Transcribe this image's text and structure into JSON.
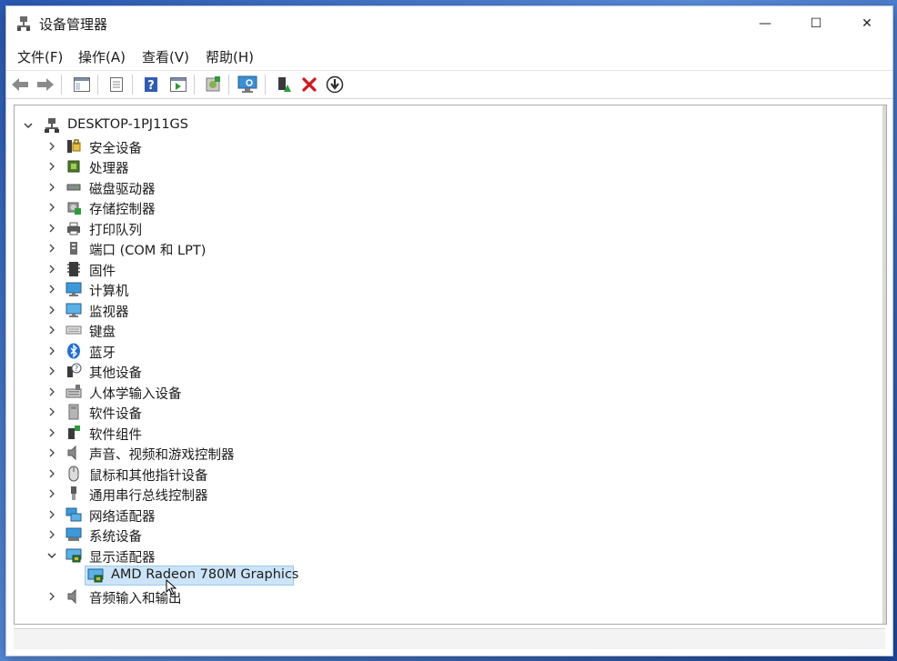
{
  "window": {
    "title": "设备管理器",
    "controls": {
      "minimize": "—",
      "maximize": "☐",
      "close": "✕"
    }
  },
  "menubar": {
    "items": [
      {
        "label": "文件(F)"
      },
      {
        "label": "操作(A)"
      },
      {
        "label": "查看(V)"
      },
      {
        "label": "帮助(H)"
      }
    ]
  },
  "toolbar": {
    "buttons": [
      {
        "icon": "back-arrow-icon"
      },
      {
        "icon": "forward-arrow-icon"
      },
      {
        "icon": "show-hide-console-tree-icon"
      },
      {
        "icon": "properties-icon"
      },
      {
        "icon": "help-icon"
      },
      {
        "icon": "action-pane-icon"
      },
      {
        "icon": "update-driver-icon"
      },
      {
        "icon": "scan-hardware-icon"
      },
      {
        "icon": "enable-device-icon"
      },
      {
        "icon": "uninstall-device-icon"
      },
      {
        "icon": "install-legacy-icon"
      }
    ]
  },
  "tree": {
    "root": {
      "label": "DESKTOP-1PJ11GS",
      "expanded": true
    },
    "categories": [
      {
        "label": "安全设备",
        "icon": "security-device-icon",
        "expanded": false
      },
      {
        "label": "处理器",
        "icon": "processor-icon",
        "expanded": false
      },
      {
        "label": "磁盘驱动器",
        "icon": "disk-drive-icon",
        "expanded": false
      },
      {
        "label": "存储控制器",
        "icon": "storage-controller-icon",
        "expanded": false
      },
      {
        "label": "打印队列",
        "icon": "printer-icon",
        "expanded": false
      },
      {
        "label": "端口 (COM 和 LPT)",
        "icon": "port-icon",
        "expanded": false
      },
      {
        "label": "固件",
        "icon": "firmware-icon",
        "expanded": false
      },
      {
        "label": "计算机",
        "icon": "computer-icon",
        "expanded": false
      },
      {
        "label": "监视器",
        "icon": "monitor-icon",
        "expanded": false
      },
      {
        "label": "键盘",
        "icon": "keyboard-icon",
        "expanded": false
      },
      {
        "label": "蓝牙",
        "icon": "bluetooth-icon",
        "expanded": false
      },
      {
        "label": "其他设备",
        "icon": "other-device-icon",
        "expanded": false
      },
      {
        "label": "人体学输入设备",
        "icon": "hid-icon",
        "expanded": false
      },
      {
        "label": "软件设备",
        "icon": "software-device-icon",
        "expanded": false
      },
      {
        "label": "软件组件",
        "icon": "software-component-icon",
        "expanded": false
      },
      {
        "label": "声音、视频和游戏控制器",
        "icon": "sound-icon",
        "expanded": false
      },
      {
        "label": "鼠标和其他指针设备",
        "icon": "mouse-icon",
        "expanded": false
      },
      {
        "label": "通用串行总线控制器",
        "icon": "usb-icon",
        "expanded": false
      },
      {
        "label": "网络适配器",
        "icon": "network-adapter-icon",
        "expanded": false
      },
      {
        "label": "系统设备",
        "icon": "system-device-icon",
        "expanded": false
      },
      {
        "label": "显示适配器",
        "icon": "display-adapter-icon",
        "expanded": true,
        "children": [
          {
            "label": "AMD Radeon 780M Graphics",
            "icon": "display-adapter-icon",
            "selected": true
          }
        ]
      },
      {
        "label": "音频输入和输出",
        "icon": "audio-io-icon",
        "expanded": false
      }
    ]
  },
  "colors": {
    "selection": "#cce4f7",
    "selection_border": "#99c9ef",
    "delete_red": "#d4141b"
  }
}
